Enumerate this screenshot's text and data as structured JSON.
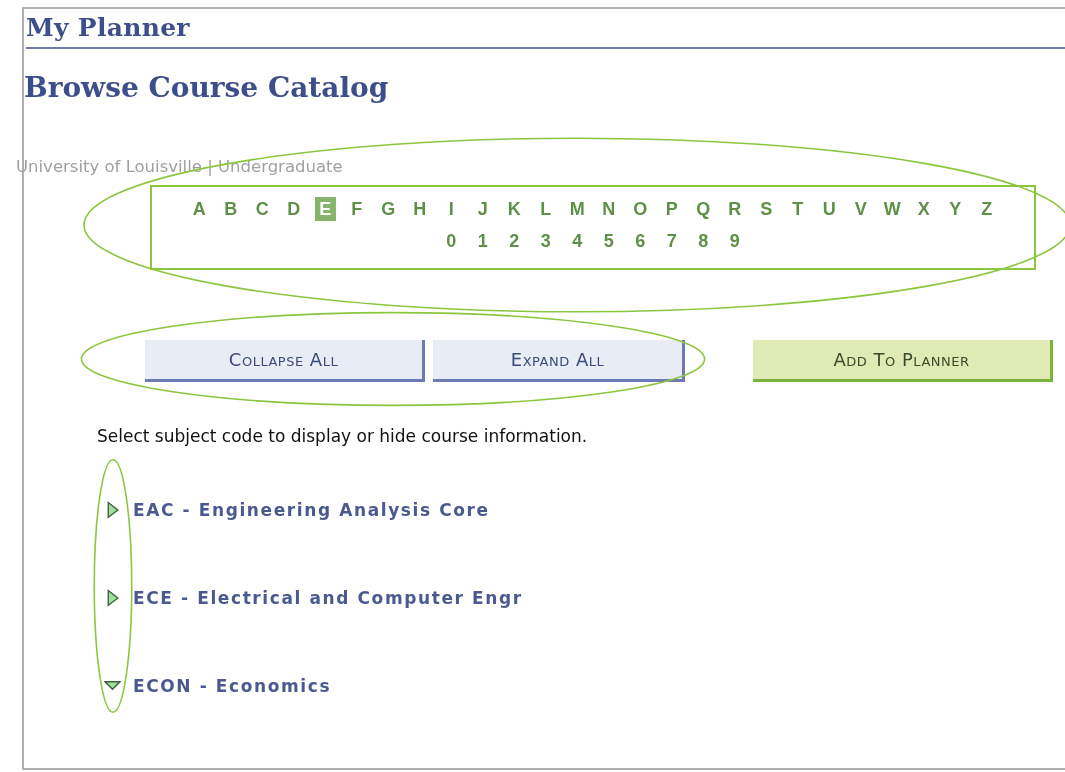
{
  "header": {
    "title": "My Planner"
  },
  "page_title": "Browse Course Catalog",
  "institution": "University of Louisville | Undergraduate",
  "alphabet": {
    "boxed": true,
    "circled": true,
    "letters": [
      {
        "label": "A",
        "selected": false
      },
      {
        "label": "B",
        "selected": false
      },
      {
        "label": "C",
        "selected": false
      },
      {
        "label": "D",
        "selected": false
      },
      {
        "label": "E",
        "selected": true
      },
      {
        "label": "F",
        "selected": false
      },
      {
        "label": "G",
        "selected": false
      },
      {
        "label": "H",
        "selected": false
      },
      {
        "label": "I",
        "selected": false
      },
      {
        "label": "J",
        "selected": false
      },
      {
        "label": "K",
        "selected": false
      },
      {
        "label": "L",
        "selected": false
      },
      {
        "label": "M",
        "selected": false
      },
      {
        "label": "N",
        "selected": false
      },
      {
        "label": "O",
        "selected": false
      },
      {
        "label": "P",
        "selected": false
      },
      {
        "label": "Q",
        "selected": false
      },
      {
        "label": "R",
        "selected": false
      },
      {
        "label": "S",
        "selected": false
      },
      {
        "label": "T",
        "selected": false
      },
      {
        "label": "U",
        "selected": false
      },
      {
        "label": "V",
        "selected": false
      },
      {
        "label": "W",
        "selected": false
      },
      {
        "label": "X",
        "selected": false
      },
      {
        "label": "Y",
        "selected": false
      },
      {
        "label": "Z",
        "selected": false
      }
    ],
    "digits": [
      {
        "label": "0",
        "selected": false
      },
      {
        "label": "1",
        "selected": false
      },
      {
        "label": "2",
        "selected": false
      },
      {
        "label": "3",
        "selected": false
      },
      {
        "label": "4",
        "selected": false
      },
      {
        "label": "5",
        "selected": false
      },
      {
        "label": "6",
        "selected": false
      },
      {
        "label": "7",
        "selected": false
      },
      {
        "label": "8",
        "selected": false
      },
      {
        "label": "9",
        "selected": false
      }
    ]
  },
  "toggle_buttons": {
    "circled": true,
    "items": [
      {
        "label": "Collapse All"
      },
      {
        "label": "Expand All"
      }
    ]
  },
  "add_button": {
    "label": "Add To Planner"
  },
  "instructions": "Select subject code to display or hide course information.",
  "subjects": {
    "circled": true,
    "items": [
      {
        "label": "EAC - Engineering Analysis Core",
        "expanded": false
      },
      {
        "label": "ECE - Electrical and Computer Engr",
        "expanded": false
      },
      {
        "label": "ECON - Economics",
        "expanded": true
      }
    ]
  }
}
